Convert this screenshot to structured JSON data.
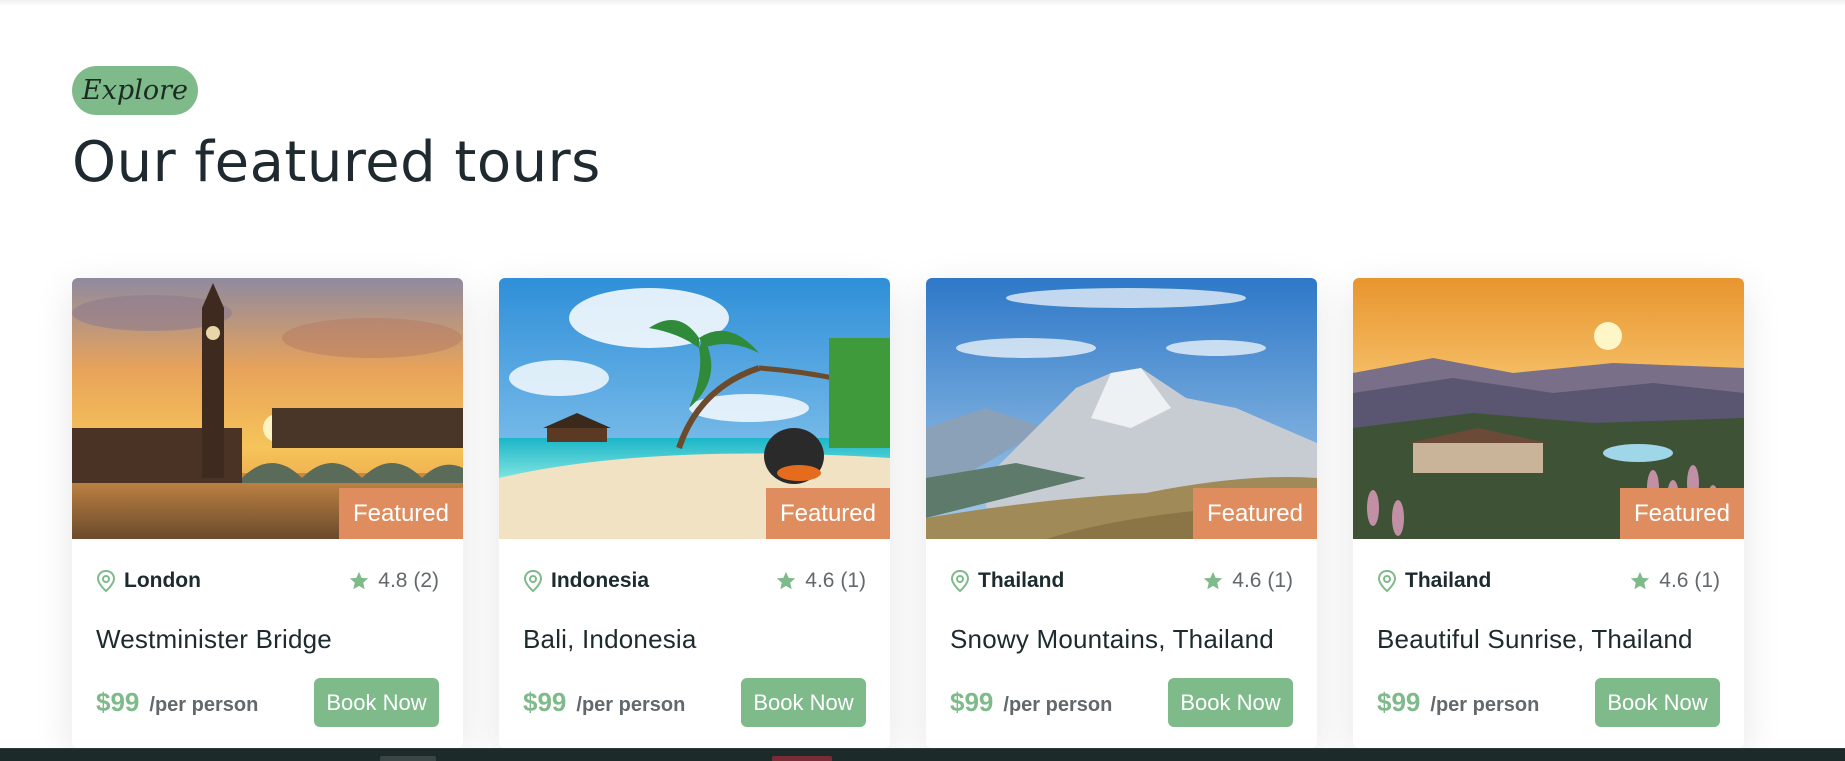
{
  "section": {
    "pill": "Explore",
    "title": "Our featured tours"
  },
  "badge_color": "#df8c5e",
  "accent_color": "#7fba8a",
  "tours": [
    {
      "badge": "Featured",
      "location": "London",
      "rating": "4.8 (2)",
      "title": "Westminister Bridge",
      "price": "$99",
      "per": "/per person",
      "cta": "Book Now"
    },
    {
      "badge": "Featured",
      "location": "Indonesia",
      "rating": "4.6 (1)",
      "title": "Bali, Indonesia",
      "price": "$99",
      "per": "/per person",
      "cta": "Book Now"
    },
    {
      "badge": "Featured",
      "location": "Thailand",
      "rating": "4.6 (1)",
      "title": "Snowy Mountains, Thailand",
      "price": "$99",
      "per": "/per person",
      "cta": "Book Now"
    },
    {
      "badge": "Featured",
      "location": "Thailand",
      "rating": "4.6 (1)",
      "title": "Beautiful Sunrise, Thailand",
      "price": "$99",
      "per": "/per person",
      "cta": "Book Now"
    }
  ],
  "icons": {
    "location": "map-pin-icon",
    "rating": "star-icon"
  }
}
